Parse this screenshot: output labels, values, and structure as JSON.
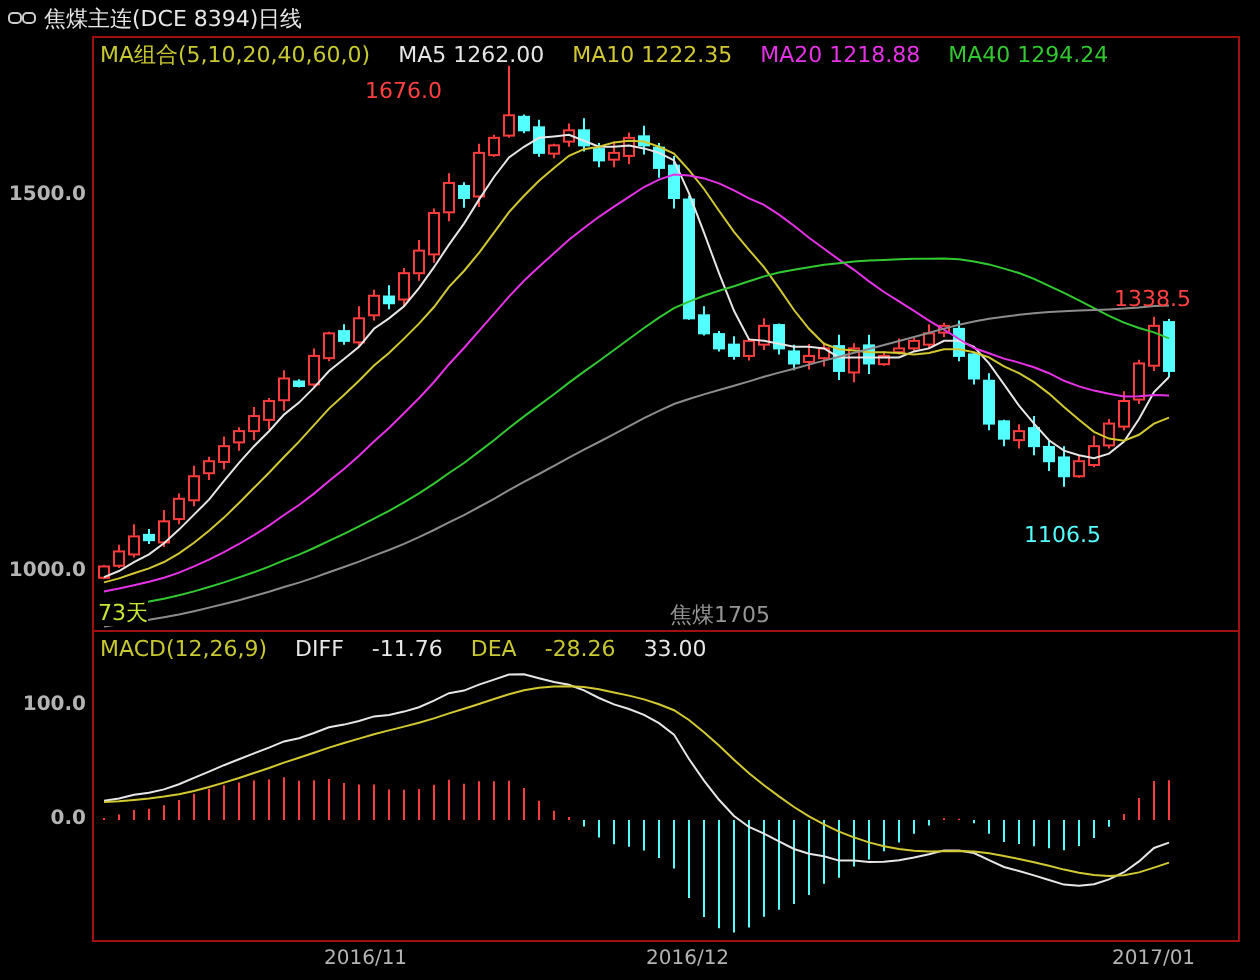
{
  "title": "焦煤主连(DCE 8394)日线",
  "legend": [
    {
      "text": "MA组合(5,10,20,40,60,0)",
      "color": "#c8c832"
    },
    {
      "text": "MA5 1262.00",
      "color": "#e6e6e6"
    },
    {
      "text": "MA10 1222.35",
      "color": "#d2c832"
    },
    {
      "text": "MA20 1218.88",
      "color": "#e632e6"
    },
    {
      "text": "MA40 1294.24",
      "color": "#32c832"
    }
  ],
  "price_axis": [
    "1500.0",
    "1000.0"
  ],
  "annotations": {
    "high": "1676.0",
    "recent_high": "1338.5",
    "low": "1106.5"
  },
  "days_label": "73天",
  "contract_label": "焦煤1705",
  "macd_legend": [
    {
      "text": "MACD(12,26,9)",
      "color": "#c8c832"
    },
    {
      "text": "DIFF",
      "color": "#e6e6e6"
    },
    {
      "text": "-11.76",
      "color": "#e6e6e6"
    },
    {
      "text": "DEA",
      "color": "#c8c832"
    },
    {
      "text": "-28.26",
      "color": "#c8c832"
    },
    {
      "text": "33.00",
      "color": "#e6e6e6"
    }
  ],
  "macd_axis": [
    "100.0",
    "0.0"
  ],
  "dates": [
    "2016/11",
    "2016/12",
    "2017/01"
  ]
}
